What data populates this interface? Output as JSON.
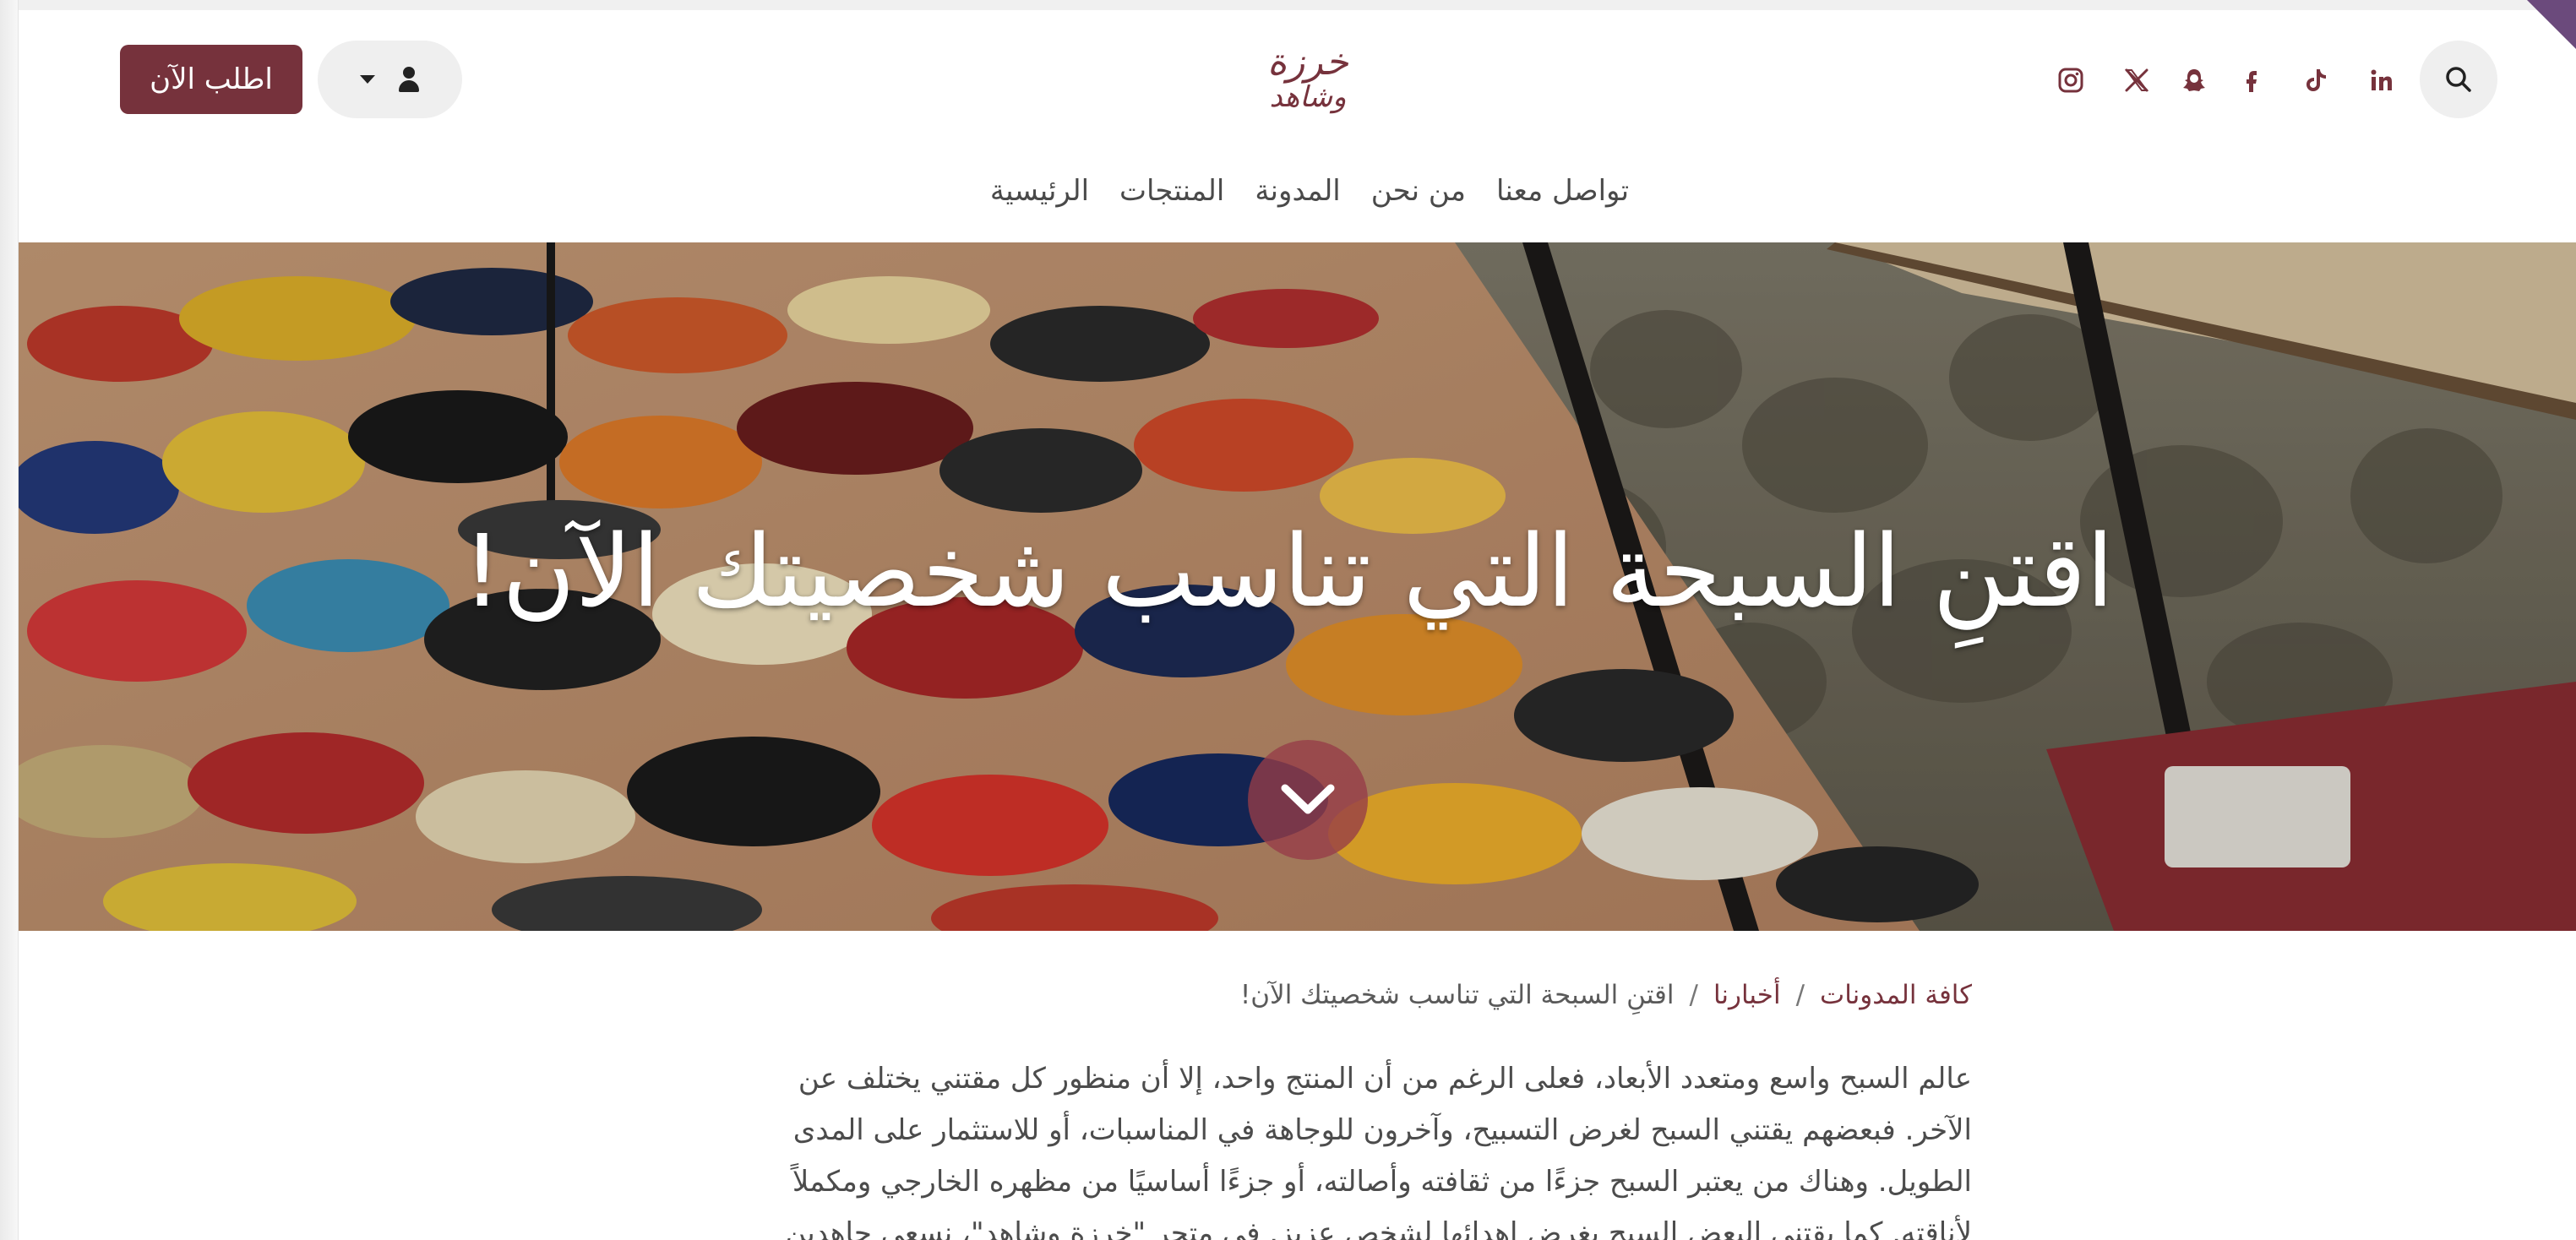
{
  "header": {
    "order_button_label": "اطلب الآن",
    "brand_line_1": "خرزة",
    "brand_line_2": "وشاهد",
    "social_icons": [
      "instagram-icon",
      "x-icon",
      "snapchat-icon",
      "facebook-icon",
      "tiktok-icon",
      "linkedin-icon"
    ],
    "accent_color": "#76323c"
  },
  "nav": {
    "items": [
      {
        "label": "الرئيسية"
      },
      {
        "label": "المنتجات"
      },
      {
        "label": "المدونة"
      },
      {
        "label": "من نحن"
      },
      {
        "label": "تواصل معنا"
      }
    ]
  },
  "hero": {
    "title": "اقتنِ السبحة التي تناسب شخصيتك الآن!"
  },
  "breadcrumb": {
    "all_blogs": "كافة المدونات",
    "category": "أخبارنا",
    "current": "اقتنِ السبحة التي تناسب شخصيتك الآن!",
    "separator": "/"
  },
  "article": {
    "lines": [
      "عالم السبح واسع ومتعدد الأبعاد، فعلى الرغم من أن المنتج واحد، إلا أن منظور كل مقتني يختلف عن",
      "الآخر. فبعضهم يقتني السبح لغرض التسبيح، وآخرون للوجاهة في المناسبات، أو للاستثمار على المدى",
      "الطويل. وهناك من يعتبر السبح جزءًا من ثقافته وأصالته، أو جزءًا أساسيًا من مظهره الخارجي ومكملاً",
      "لأناقته. كما يقتني البعض السبح بغرض إهدائها لشخص عزيز. في متجر \"خرزة وشاهد\"، نسعى جاهدين"
    ]
  }
}
